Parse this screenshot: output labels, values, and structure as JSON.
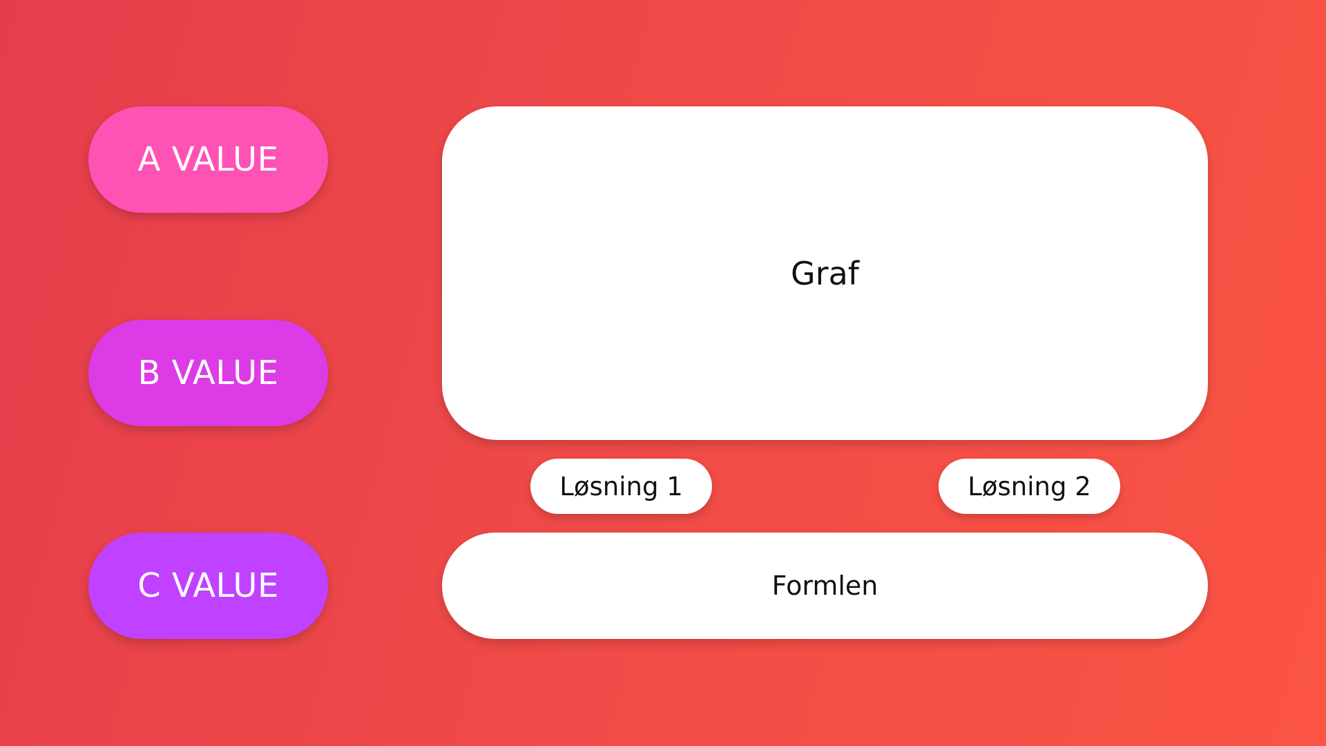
{
  "inputs": {
    "a": {
      "label": "A VALUE",
      "color": "#ff52b5"
    },
    "b": {
      "label": "B VALUE",
      "color": "#dc3be6"
    },
    "c": {
      "label": "C VALUE",
      "color": "#c041ff"
    }
  },
  "graph": {
    "label": "Graf"
  },
  "solutions": [
    {
      "label": "Løsning 1"
    },
    {
      "label": "Løsning 2"
    }
  ],
  "formula": {
    "label": "Formlen"
  },
  "colors": {
    "background_start": "#e53d4c",
    "background_end": "#fb5444",
    "card": "#ffffff",
    "text_dark": "#111111",
    "text_light": "#ffffff"
  }
}
